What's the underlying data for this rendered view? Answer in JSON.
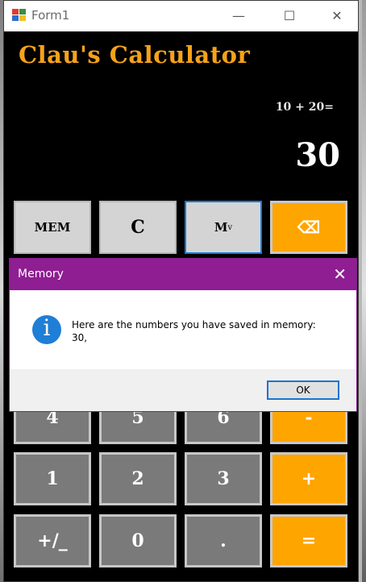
{
  "window": {
    "title": "Form1",
    "controls": {
      "minimize": "—",
      "maximize": "☐",
      "close": "✕"
    }
  },
  "calculator": {
    "heading": "Clau's Calculator",
    "expression": "10 + 20=",
    "result": "30",
    "buttons": {
      "mem": "MEM",
      "clear": "C",
      "mv": "M",
      "mv_sub": "v",
      "backspace": "⌫",
      "four": "4",
      "five": "5",
      "six": "6",
      "minus": "-",
      "one": "1",
      "two": "2",
      "three": "3",
      "plus": "+",
      "sign": "+/_",
      "zero": "0",
      "dot": ".",
      "equals": "="
    }
  },
  "dialog": {
    "title": "Memory",
    "close": "✕",
    "icon": "info-icon",
    "icon_glyph": "i",
    "message_line1": "Here are the numbers you have saved in memory:",
    "message_line2": "30,",
    "ok_label": "OK"
  },
  "colors": {
    "accent_orange": "#ffa500",
    "heading_orange": "#f6a21a",
    "dialog_purple": "#8e1e92",
    "info_blue": "#1f7ed6",
    "focus_blue": "#1b79d6"
  }
}
